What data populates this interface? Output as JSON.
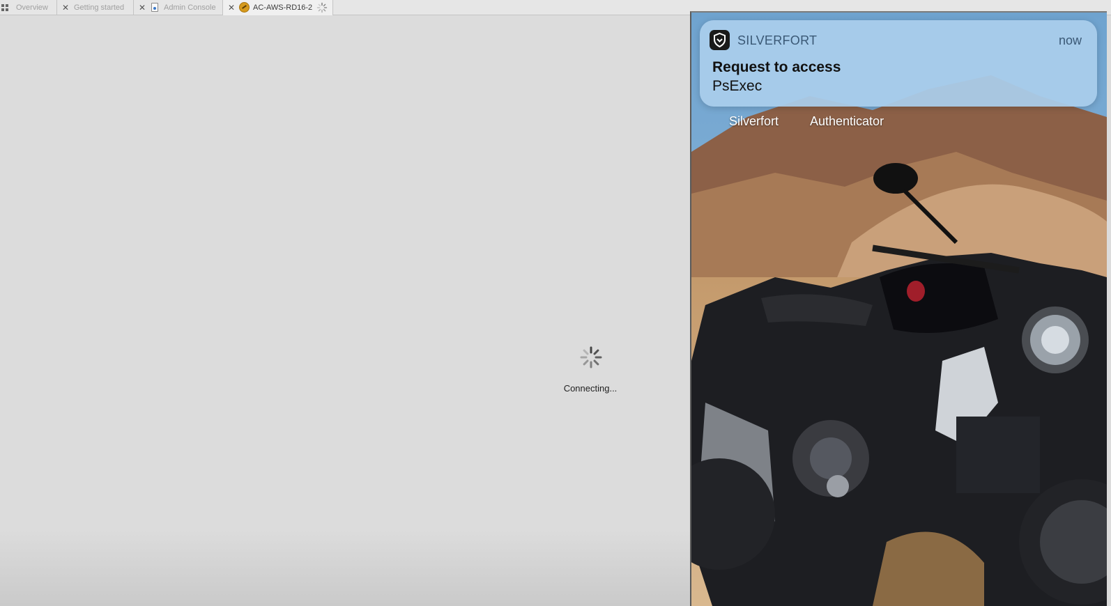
{
  "tabs": [
    {
      "label": "Overview",
      "icon": "grid-icon",
      "active": false
    },
    {
      "label": "Getting started",
      "active": false
    },
    {
      "label": "Admin Console",
      "icon": "document-icon",
      "active": false
    },
    {
      "label": "AC-AWS-RD16-2",
      "icon": "remote-desktop-icon",
      "active": true,
      "loading": true
    }
  ],
  "close_glyph": "✕",
  "main": {
    "status_text": "Connecting..."
  },
  "phone": {
    "app_labels": [
      "Silverfort",
      "Authenticator"
    ],
    "notification": {
      "app_name": "SILVERFORT",
      "time": "now",
      "title": "Request to access",
      "body": "PsExec",
      "icon": "silverfort-shield-icon"
    }
  },
  "colors": {
    "background": "#dcdcdc",
    "notification_bg": "#aacdec",
    "notification_app_text": "#3a5875"
  }
}
